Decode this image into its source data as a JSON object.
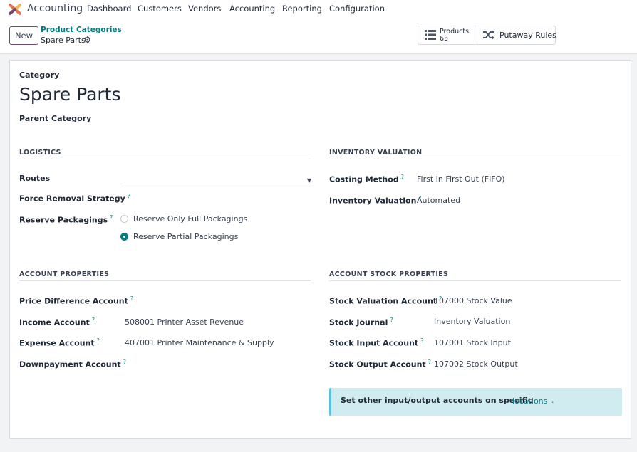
{
  "topbar": {
    "app_name": "Accounting",
    "menu": [
      "Dashboard",
      "Customers",
      "Vendors",
      "Accounting",
      "Reporting",
      "Configuration"
    ]
  },
  "control_panel": {
    "new_label": "New",
    "breadcrumb_parent": "Product Categories",
    "breadcrumb_current": "Spare Parts",
    "smart_buttons": {
      "products_label": "Products",
      "products_count": "63",
      "putaway_label": "Putaway Rules"
    }
  },
  "form": {
    "category_label": "Category",
    "title": "Spare Parts",
    "parent_category_label": "Parent Category",
    "logistics": {
      "title": "LOGISTICS",
      "routes_label": "Routes",
      "force_removal_label": "Force Removal Strategy",
      "reserve_packagings_label": "Reserve Packagings",
      "options": [
        "Reserve Only Full Packagings",
        "Reserve Partial Packagings"
      ],
      "selected_option": "Reserve Partial Packagings"
    },
    "inventory_valuation": {
      "title": "INVENTORY VALUATION",
      "costing_method_label": "Costing Method",
      "costing_method_value": "First In First Out (FIFO)",
      "inventory_valuation_label": "Inventory Valuation",
      "inventory_valuation_value": "Automated"
    },
    "account_properties": {
      "title": "ACCOUNT PROPERTIES",
      "price_difference_label": "Price Difference Account",
      "income_label": "Income Account",
      "income_value": "508001 Printer Asset Revenue",
      "expense_label": "Expense Account",
      "expense_value": "407001 Printer Maintenance & Supply",
      "downpayment_label": "Downpayment Account"
    },
    "account_stock_properties": {
      "title": "ACCOUNT STOCK PROPERTIES",
      "stock_valuation_label": "Stock Valuation Account",
      "stock_valuation_value": "107000 Stock Value",
      "stock_journal_label": "Stock Journal",
      "stock_journal_value": "Inventory Valuation",
      "stock_input_label": "Stock Input Account",
      "stock_input_value": "107001 Stock Input",
      "stock_output_label": "Stock Output Account",
      "stock_output_value": "107002 Stock Output"
    },
    "alert": {
      "text": "Set other input/output accounts on specific",
      "link": "locations",
      "dot": "."
    },
    "help_marker": "?"
  },
  "colors": {
    "brand": "#714b67",
    "link": "#017e84",
    "alert_bg": "#d1ecf1"
  },
  "icons": {
    "app": "accounting-logo-icon",
    "gear": "gear-icon",
    "products": "list-icon",
    "putaway": "shuffle-icon",
    "dropdown": "caret-down-icon"
  }
}
